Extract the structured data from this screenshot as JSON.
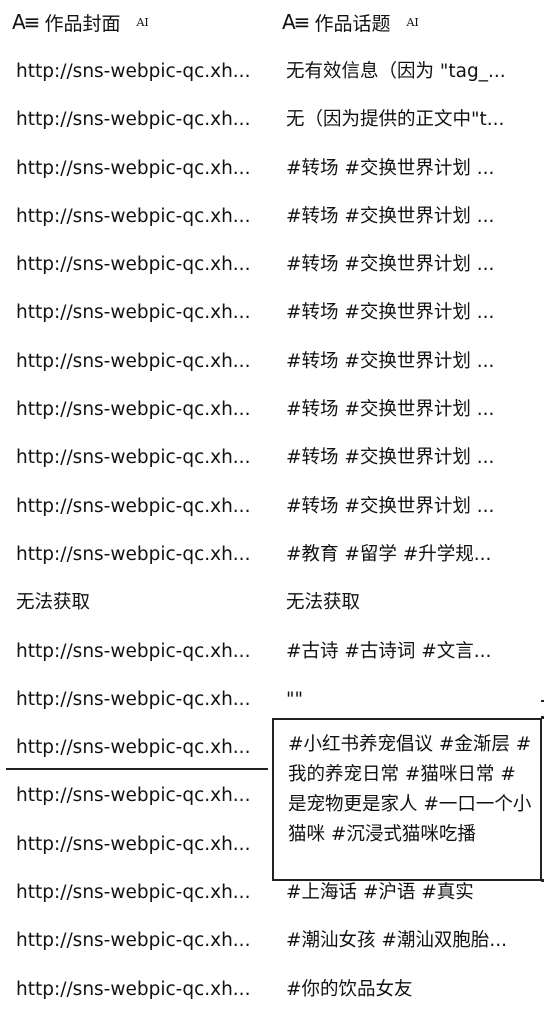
{
  "header": {
    "col1": {
      "icon": "text-type-icon",
      "title": "作品封面",
      "ai": "AI"
    },
    "col2": {
      "icon": "text-type-icon",
      "title": "作品话题",
      "ai": "AI"
    }
  },
  "rows": [
    {
      "cover": "http://sns-webpic-qc.xh...",
      "topic": "无有效信息（因为 \"tag_..."
    },
    {
      "cover": "http://sns-webpic-qc.xh...",
      "topic": "无（因为提供的正文中\"t..."
    },
    {
      "cover": "http://sns-webpic-qc.xh...",
      "topic": "#转场 #交换世界计划 ..."
    },
    {
      "cover": "http://sns-webpic-qc.xh...",
      "topic": "#转场 #交换世界计划 ..."
    },
    {
      "cover": "http://sns-webpic-qc.xh...",
      "topic": "#转场 #交换世界计划 ..."
    },
    {
      "cover": "http://sns-webpic-qc.xh...",
      "topic": "#转场 #交换世界计划 ..."
    },
    {
      "cover": "http://sns-webpic-qc.xh...",
      "topic": "#转场 #交换世界计划 ..."
    },
    {
      "cover": "http://sns-webpic-qc.xh...",
      "topic": "#转场 #交换世界计划 ..."
    },
    {
      "cover": "http://sns-webpic-qc.xh...",
      "topic": "#转场 #交换世界计划 ..."
    },
    {
      "cover": "http://sns-webpic-qc.xh...",
      "topic": "#转场 #交换世界计划 ..."
    },
    {
      "cover": "http://sns-webpic-qc.xh...",
      "topic": "#教育 #留学 #升学规..."
    },
    {
      "cover": "无法获取",
      "topic": "无法获取"
    },
    {
      "cover": "http://sns-webpic-qc.xh...",
      "topic": "#古诗 #古诗词 #文言..."
    },
    {
      "cover": "http://sns-webpic-qc.xh...",
      "topic": "\"\""
    },
    {
      "cover": "http://sns-webpic-qc.xh...",
      "topic": ""
    },
    {
      "cover": "http://sns-webpic-qc.xh...",
      "topic": ""
    },
    {
      "cover": "http://sns-webpic-qc.xh...",
      "topic": ""
    },
    {
      "cover": "http://sns-webpic-qc.xh...",
      "topic": "#上海话 #沪语 #真实"
    },
    {
      "cover": "http://sns-webpic-qc.xh...",
      "topic": "#潮汕女孩 #潮汕双胞胎..."
    },
    {
      "cover": "http://sns-webpic-qc.xh...",
      "topic": "#你的饮品女友"
    }
  ],
  "editor": {
    "text": "#小红书养宠倡议 #金渐层 #我的养宠日常 #猫咪日常 #是宠物更是家人 #一口一个小猫咪 #沉浸式猫咪吃播"
  }
}
